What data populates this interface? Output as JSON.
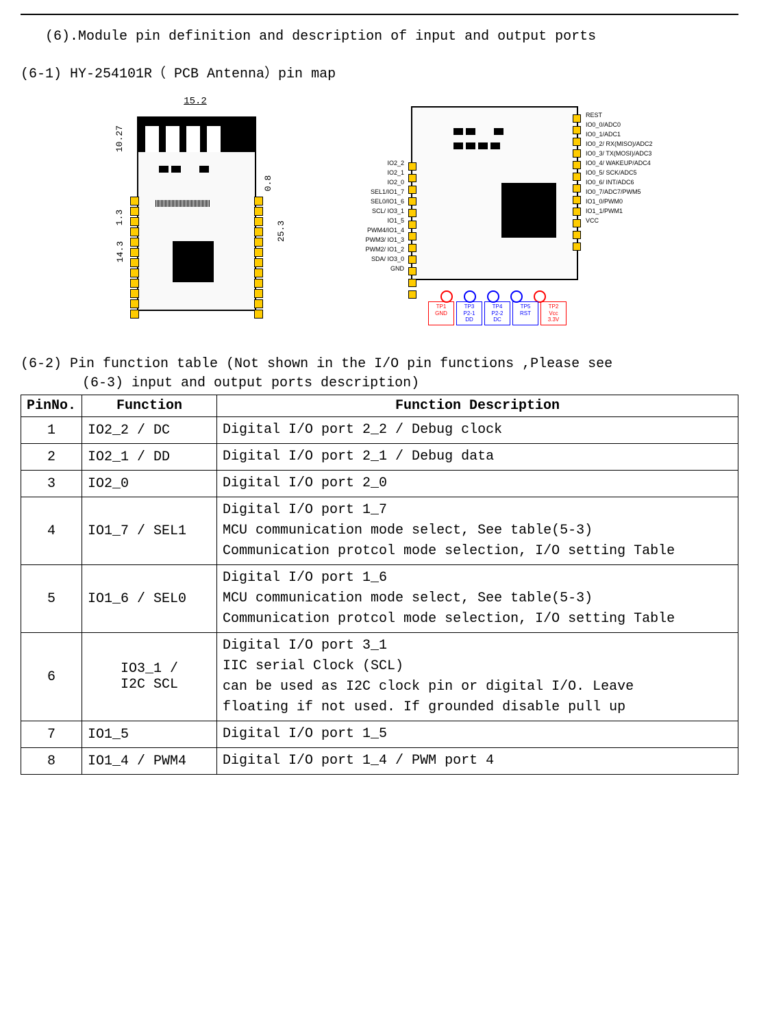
{
  "section_title": "(6).Module pin definition and description of input and output ports",
  "sub1_title": "(6-1) HY-254101R（ PCB Antenna）pin map",
  "sub2_title": "(6-2) Pin function table (Not shown in the I/O pin functions ,Please see",
  "sub2_note": "(6-3) input and output ports description)",
  "dim_top": "15.2",
  "dim_left_1": "10.27",
  "dim_left_2": "1.3",
  "dim_left_3": "14.3",
  "dim_right_1": "0.8",
  "dim_right_2": "25.3",
  "left_labels": [
    "IO2_2",
    "IO2_1",
    "IO2_0",
    "SEL1/IO1_7",
    "SEL0/IO1_6",
    "SCL/ IO3_1",
    "IO1_5",
    "PWM4/IO1_4",
    "PWM3/ IO1_3",
    "PWM2/ IO1_2",
    "SDA/ IO3_0",
    "GND"
  ],
  "right_labels": [
    "REST",
    "IO0_0/ADC0",
    "IO0_1/ADC1",
    "IO0_2/ RX(MISO)/ADC2",
    "IO0_3/ TX(MOSI)/ADC3",
    "IO0_4/ WAKEUP/ADC4",
    "IO0_5/ SCK/ADC5",
    "IO0_6/ INT/ADC6",
    "IO0_7/ADC7/PWM5",
    "IO1_0/PWM0",
    "IO1_1/PWM1",
    "VCC"
  ],
  "tp": [
    {
      "t1": "TP1",
      "t2": "GND",
      "cls": "tp-red"
    },
    {
      "t1": "TP3",
      "t2": "P2-1",
      "t3": "DD",
      "cls": "tp-blue"
    },
    {
      "t1": "TP4",
      "t2": "P2-2",
      "t3": "DC",
      "cls": "tp-blue"
    },
    {
      "t1": "TP5",
      "t2": "RST",
      "cls": "tp-blue"
    },
    {
      "t1": "TP2",
      "t2": "Vcc",
      "t3": "3.3V",
      "cls": "tp-red"
    }
  ],
  "table_headers": {
    "pinno": "PinNo.",
    "func": "Function",
    "desc": "Function  Description"
  },
  "rows": [
    {
      "no": "1",
      "func": "IO2_2 / DC",
      "desc": "Digital I/O port 2_2   / Debug clock"
    },
    {
      "no": "2",
      "func": "IO2_1 / DD",
      "desc": "Digital I/O port 2_1  /  Debug data"
    },
    {
      "no": "3",
      "func": "IO2_0",
      "desc": "Digital I/O port 2_0"
    },
    {
      "no": "4",
      "func": "IO1_7 / SEL1",
      "desc": "Digital I/O port 1_7\nMCU communication mode select, See table(5-3)\n Communication protcol mode selection, I/O setting Table"
    },
    {
      "no": "5",
      "func": "IO1_6 / SEL0",
      "desc": "Digital I/O port 1_6\nMCU communication mode select, See table(5-3)\n Communication protcol mode selection, I/O setting Table"
    },
    {
      "no": "6",
      "func": "IO3_1 /\nI2C  SCL",
      "center": true,
      "desc": "Digital I/O port 3_1\nIIC serial Clock (SCL)\ncan be used as I2C clock pin or digital I/O. Leave\nfloating if not used. If grounded disable pull up"
    },
    {
      "no": "7",
      "func": "IO1_5",
      "desc": "Digital I/O port 1_5"
    },
    {
      "no": "8",
      "func": "IO1_4 / PWM4",
      "desc": "Digital I/O port 1_4  / PWM port 4"
    }
  ]
}
